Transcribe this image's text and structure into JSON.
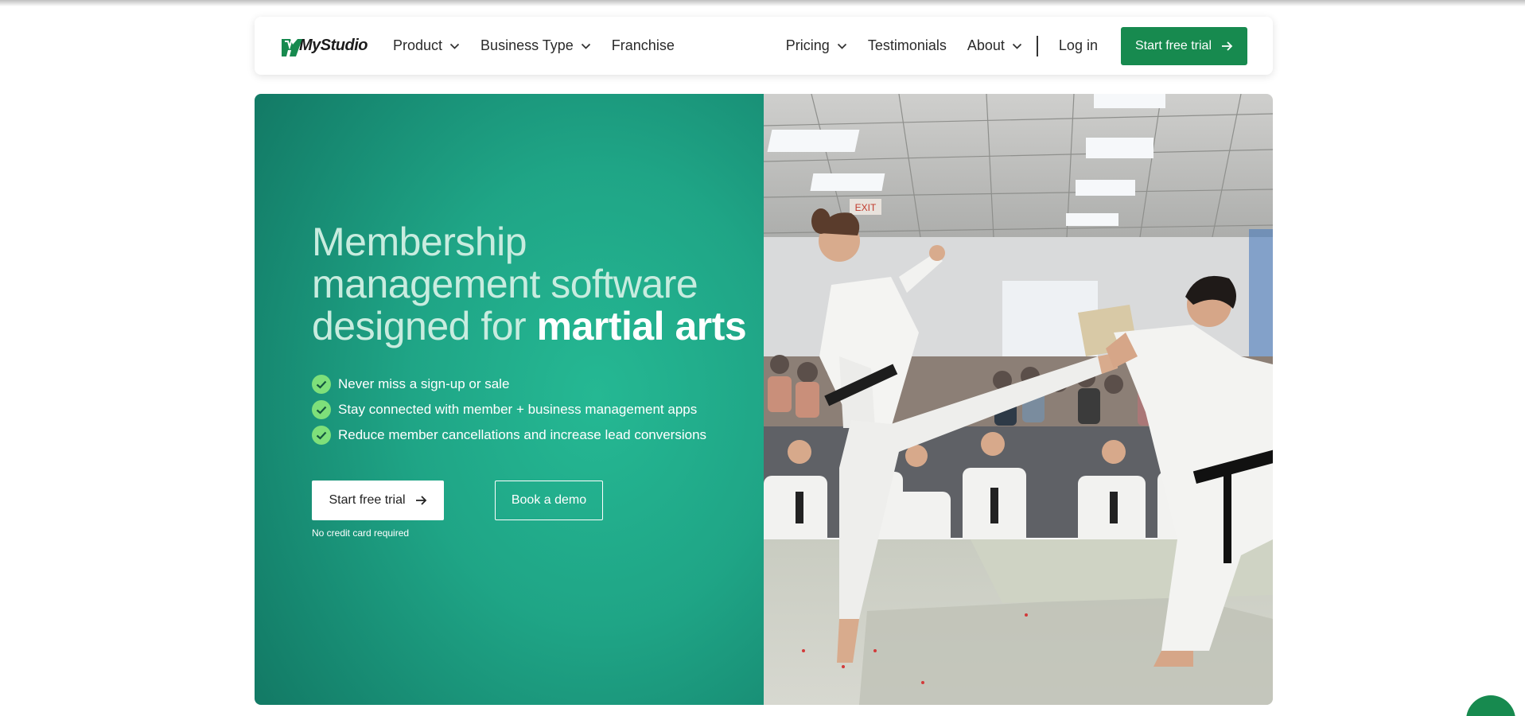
{
  "brand": {
    "logo_text": "MyStudio",
    "accent_color": "#178a4f",
    "hero_color": "#1fa586"
  },
  "nav": {
    "left_items": [
      {
        "label": "Product",
        "has_dropdown": true
      },
      {
        "label": "Business Type",
        "has_dropdown": true
      },
      {
        "label": "Franchise",
        "has_dropdown": false
      }
    ],
    "right_items": [
      {
        "label": "Pricing",
        "has_dropdown": true
      },
      {
        "label": "Testimonials",
        "has_dropdown": false
      },
      {
        "label": "About",
        "has_dropdown": true
      }
    ],
    "login_label": "Log in",
    "cta_label": "Start free trial"
  },
  "hero": {
    "headline_line1": "Membership",
    "headline_line2": "management software",
    "headline_line3_prefix": "designed for",
    "headline_line3_bold": "martial arts",
    "bullets": [
      "Never miss a sign-up or sale",
      "Stay connected with member + business management apps",
      "Reduce member cancellations and increase lead conversions"
    ],
    "primary_cta_label": "Start free trial",
    "secondary_cta_label": "Book a demo",
    "footnote": "No credit card required",
    "image_subject": "martial arts board-breaking kick photo",
    "image_exit_sign": "EXIT"
  },
  "icons": {
    "check": "check-circle-icon",
    "arrow": "arrow-right-icon",
    "chevron": "chevron-down-icon",
    "chat": "chat-icon"
  }
}
